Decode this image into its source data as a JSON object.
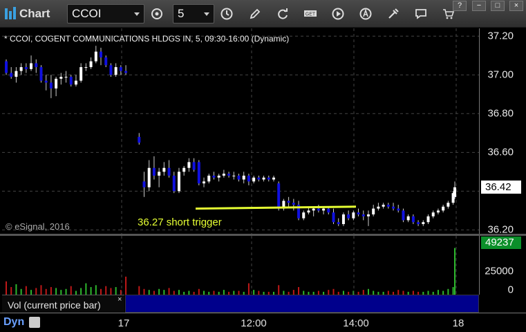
{
  "toolbar": {
    "title": "Chart",
    "symbol": "CCOI",
    "interval": "5",
    "icons": [
      "gear-icon",
      "clock-icon",
      "pencil-icon",
      "refresh-icon",
      "get-icon",
      "play-icon",
      "alert-icon",
      "tools-icon",
      "comment-icon"
    ]
  },
  "window": {
    "help": "?",
    "minimize": "−",
    "maximize": "□",
    "close": "×"
  },
  "chart_title": "* CCOI, COGENT COMMUNICATIONS HLDGS IN, 5, 09:30-16:00 (Dynamic)",
  "copyright": "© eSignal, 2016",
  "annotation": "36.27 short trigger",
  "price_axis": {
    "labels": [
      "37.20",
      "37.00",
      "36.80",
      "36.60",
      "36.20"
    ],
    "last_price": "36.42"
  },
  "volume_axis": {
    "labels": [
      "25000",
      "0"
    ],
    "last_volume": "49237"
  },
  "volume_study_label": "Vol (current price bar)",
  "volume_close": "×",
  "time_axis": {
    "labels": [
      "17",
      "12:00",
      "14:00",
      "18"
    ]
  },
  "footer": {
    "mode": "Dyn"
  },
  "chart_data": {
    "type": "candlestick",
    "ylim": [
      36.18,
      37.24
    ],
    "candles": [
      [
        37.07,
        37.08,
        37.0,
        37.01
      ],
      [
        37.01,
        37.04,
        36.98,
        36.99
      ],
      [
        36.99,
        37.04,
        36.96,
        37.02
      ],
      [
        37.02,
        37.06,
        37.0,
        37.04
      ],
      [
        37.04,
        37.06,
        37.01,
        37.03
      ],
      [
        37.03,
        37.1,
        37.02,
        37.06
      ],
      [
        37.06,
        37.08,
        37.01,
        37.04
      ],
      [
        37.04,
        37.05,
        36.96,
        36.97
      ],
      [
        36.97,
        37.0,
        36.92,
        36.96
      ],
      [
        36.96,
        37.0,
        36.88,
        36.93
      ],
      [
        36.93,
        36.99,
        36.89,
        36.98
      ],
      [
        36.98,
        37.01,
        36.95,
        36.99
      ],
      [
        36.99,
        37.02,
        36.96,
        36.99
      ],
      [
        36.99,
        37.0,
        36.94,
        36.95
      ],
      [
        36.95,
        37.0,
        36.94,
        36.97
      ],
      [
        36.97,
        37.06,
        36.96,
        37.04
      ],
      [
        37.04,
        37.06,
        37.02,
        37.04
      ],
      [
        37.04,
        37.09,
        37.03,
        37.07
      ],
      [
        37.07,
        37.15,
        37.06,
        37.12
      ],
      [
        37.12,
        37.14,
        37.05,
        37.09
      ],
      [
        37.09,
        37.1,
        37.04,
        37.05
      ],
      [
        37.05,
        37.06,
        36.99,
        37.0
      ],
      [
        37.0,
        37.06,
        36.99,
        37.04
      ],
      [
        37.04,
        37.05,
        37.0,
        37.02
      ],
      [
        37.02,
        37.05,
        37.0,
        37.01
      ],
      [
        36.68,
        36.7,
        36.64,
        36.65
      ],
      [
        36.45,
        36.5,
        36.37,
        36.42
      ],
      [
        36.42,
        36.56,
        36.4,
        36.52
      ],
      [
        36.52,
        36.58,
        36.46,
        36.48
      ],
      [
        36.48,
        36.52,
        36.42,
        36.5
      ],
      [
        36.5,
        36.55,
        36.48,
        36.52
      ],
      [
        36.52,
        36.56,
        36.47,
        36.48
      ],
      [
        36.48,
        36.5,
        36.39,
        36.4
      ],
      [
        36.4,
        36.52,
        36.39,
        36.5
      ],
      [
        36.5,
        36.53,
        36.48,
        36.52
      ],
      [
        36.52,
        36.57,
        36.5,
        36.55
      ],
      [
        36.55,
        36.57,
        36.5,
        36.51
      ],
      [
        36.55,
        36.56,
        36.43,
        36.44
      ],
      [
        36.44,
        36.47,
        36.42,
        36.45
      ],
      [
        36.45,
        36.49,
        36.44,
        36.48
      ],
      [
        36.48,
        36.5,
        36.46,
        36.47
      ],
      [
        36.47,
        36.49,
        36.45,
        36.48
      ],
      [
        36.48,
        36.51,
        36.47,
        36.49
      ],
      [
        36.49,
        36.5,
        36.47,
        36.48
      ],
      [
        36.48,
        36.5,
        36.46,
        36.48
      ],
      [
        36.48,
        36.49,
        36.45,
        36.46
      ],
      [
        36.46,
        36.5,
        36.44,
        36.48
      ],
      [
        36.48,
        36.49,
        36.43,
        36.45
      ],
      [
        36.45,
        36.48,
        36.44,
        36.47
      ],
      [
        36.47,
        36.48,
        36.45,
        36.46
      ],
      [
        36.46,
        36.48,
        36.45,
        36.47
      ],
      [
        36.47,
        36.48,
        36.45,
        36.46
      ],
      [
        36.46,
        36.48,
        36.45,
        36.47
      ],
      [
        36.44,
        36.45,
        36.3,
        36.31
      ],
      [
        36.31,
        36.36,
        36.3,
        36.35
      ],
      [
        36.35,
        36.37,
        36.32,
        36.34
      ],
      [
        36.34,
        36.36,
        36.3,
        36.33
      ],
      [
        36.33,
        36.35,
        36.25,
        36.26
      ],
      [
        36.26,
        36.3,
        36.25,
        36.29
      ],
      [
        36.29,
        36.32,
        36.28,
        36.3
      ],
      [
        36.3,
        36.32,
        36.27,
        36.31
      ],
      [
        36.31,
        36.33,
        36.29,
        36.3
      ],
      [
        36.3,
        36.32,
        36.28,
        36.31
      ],
      [
        36.31,
        36.32,
        36.28,
        36.29
      ],
      [
        36.29,
        36.31,
        36.23,
        36.24
      ],
      [
        36.24,
        36.26,
        36.22,
        36.23
      ],
      [
        36.23,
        36.29,
        36.22,
        36.28
      ],
      [
        36.28,
        36.3,
        36.25,
        36.26
      ],
      [
        36.26,
        36.3,
        36.25,
        36.29
      ],
      [
        36.29,
        36.31,
        36.27,
        36.28
      ],
      [
        36.28,
        36.3,
        36.25,
        36.27
      ],
      [
        36.27,
        36.3,
        36.22,
        36.28
      ],
      [
        36.28,
        36.33,
        36.27,
        36.31
      ],
      [
        36.31,
        36.34,
        36.3,
        36.32
      ],
      [
        36.32,
        36.34,
        36.31,
        36.33
      ],
      [
        36.33,
        36.34,
        36.31,
        36.32
      ],
      [
        36.32,
        36.34,
        36.3,
        36.31
      ],
      [
        36.31,
        36.33,
        36.29,
        36.3
      ],
      [
        36.3,
        36.31,
        36.24,
        36.25
      ],
      [
        36.25,
        36.28,
        36.24,
        36.27
      ],
      [
        36.27,
        36.28,
        36.23,
        36.24
      ],
      [
        36.24,
        36.25,
        36.22,
        36.23
      ],
      [
        36.23,
        36.25,
        36.22,
        36.24
      ],
      [
        36.24,
        36.28,
        36.23,
        36.27
      ],
      [
        36.27,
        36.3,
        36.26,
        36.29
      ],
      [
        36.29,
        36.31,
        36.28,
        36.3
      ],
      [
        36.3,
        36.33,
        36.29,
        36.32
      ],
      [
        36.32,
        36.35,
        36.31,
        36.34
      ],
      [
        36.34,
        36.4,
        36.33,
        36.39
      ],
      [
        36.39,
        36.43,
        36.36,
        36.37
      ],
      [
        36.37,
        36.45,
        36.36,
        36.42
      ]
    ],
    "volumes": [
      14000,
      8000,
      11000,
      6000,
      9000,
      5000,
      7000,
      10000,
      6000,
      8000,
      7000,
      5000,
      6000,
      9000,
      4000,
      7000,
      12000,
      8000,
      10000,
      6000,
      9000,
      7000,
      8000,
      5000,
      19000,
      9000,
      6000,
      5000,
      4000,
      6000,
      5000,
      7000,
      4000,
      5000,
      3000,
      4000,
      3000,
      6000,
      4000,
      3000,
      4000,
      3000,
      5000,
      3000,
      4000,
      4000,
      3000,
      12000,
      5000,
      4000,
      3000,
      3000,
      3000,
      10000,
      4000,
      3000,
      5000,
      8000,
      4000,
      3000,
      3000,
      4000,
      3000,
      5000,
      6000,
      3000,
      4000,
      3000,
      4000,
      3000,
      5000,
      6000,
      4000,
      3000,
      3000,
      4000,
      3000,
      5000,
      4000,
      3000,
      4000,
      3000,
      3000,
      4000,
      3000,
      5000,
      4000,
      6000,
      8000,
      16000,
      49237
    ],
    "trendline": {
      "start": 36.31,
      "end": 36.32,
      "color": "#e6ff33"
    }
  }
}
